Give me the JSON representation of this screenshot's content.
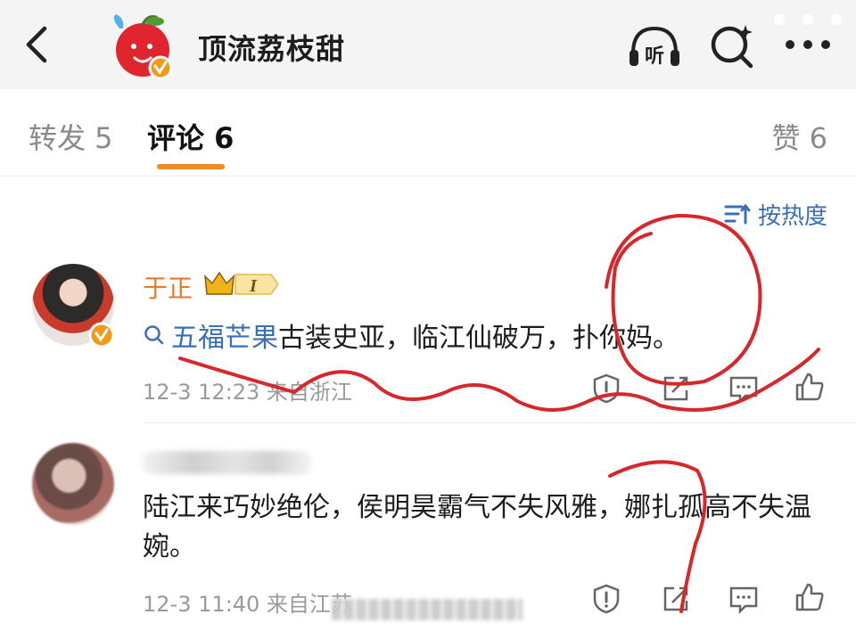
{
  "header": {
    "title": "顶流荔枝甜",
    "listen_label": "听"
  },
  "tabs": [
    {
      "label": "转发 5"
    },
    {
      "label": "评论 6"
    },
    {
      "label": "赞 6"
    }
  ],
  "sort": {
    "label": "按热度"
  },
  "comments": [
    {
      "author": "于正",
      "badge_level": "I",
      "topic": "五福芒果",
      "text": "古装史亚，临江仙破万，扑你妈。",
      "meta": "12-3 12:23 来自浙江"
    },
    {
      "text": "陆江来巧妙绝伦，侯明昊霸气不失风雅，娜扎孤高不失温婉。",
      "meta": "12-3 11:40 来自江苏"
    }
  ],
  "colors": {
    "accent": "#f08a24",
    "link": "#3b6fb6",
    "author": "#e8772e",
    "annotation": "#d8262b"
  }
}
